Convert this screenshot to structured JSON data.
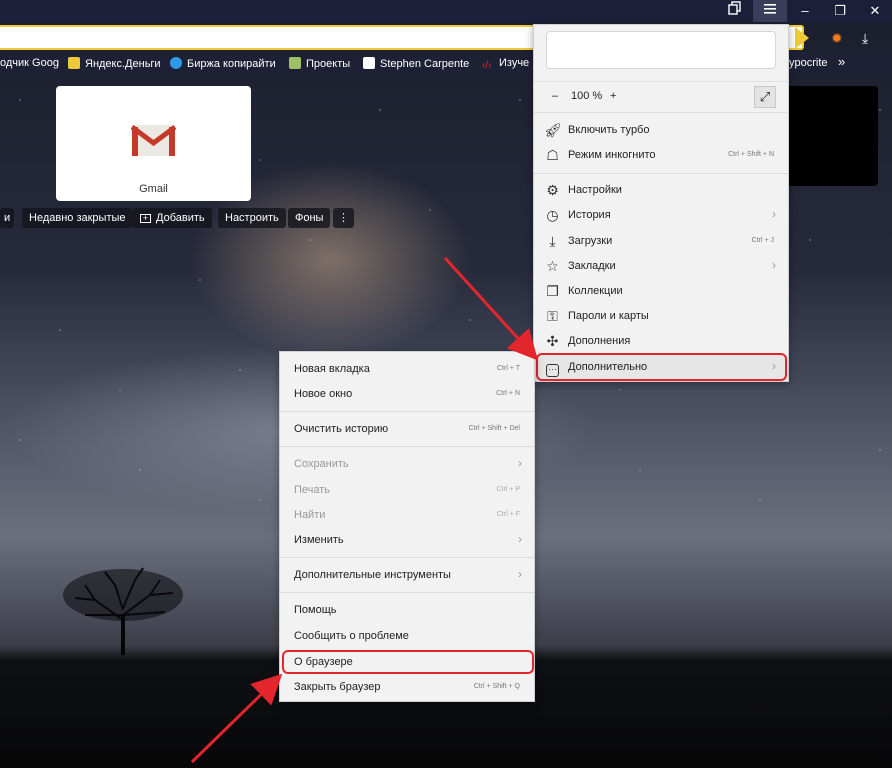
{
  "window": {
    "collections_icon": "collections-icon",
    "menu_icon": "hamburger-menu-icon",
    "minimize": "–",
    "restore": "❐",
    "close": "✕",
    "download": "⤓"
  },
  "bookmarks": [
    {
      "label": "одчик Goog",
      "color": "#ffffff"
    },
    {
      "label": "Яндекс.Деньги",
      "color": "#f0c93a"
    },
    {
      "label": "Биржа копирайти",
      "color": "#2d9ae6"
    },
    {
      "label": "Проекты",
      "color": "#9fbf6a"
    },
    {
      "label": "Stephen Carpente",
      "color": "#ffffff"
    },
    {
      "label": "Изуче",
      "color": "#e3262c"
    }
  ],
  "bookmarks_more_fragment": "ypocrite",
  "bookmarks_chevron": "»",
  "tile": {
    "label": "Gmail"
  },
  "toolbar": {
    "left_fragment": "и",
    "recently_closed": "Недавно закрытые",
    "add": "Добавить",
    "configure": "Настроить",
    "backgrounds": "Фоны",
    "more": "⋮"
  },
  "main_menu": {
    "zoom_minus": "–",
    "zoom_value": "100 %",
    "zoom_plus": "+",
    "items": [
      {
        "label": "Включить турбо",
        "icon": "rocket-icon",
        "shortcut": "",
        "arrow": ""
      },
      {
        "label": "Режим инкогнито",
        "icon": "incognito-icon",
        "shortcut": "Ctrl + Shift + N",
        "arrow": ""
      },
      {
        "label": "Настройки",
        "icon": "gear-icon",
        "shortcut": "",
        "arrow": ""
      },
      {
        "label": "История",
        "icon": "clock-icon",
        "shortcut": "",
        "arrow": "›"
      },
      {
        "label": "Загрузки",
        "icon": "download-icon",
        "shortcut": "Ctrl + J",
        "arrow": ""
      },
      {
        "label": "Закладки",
        "icon": "star-icon",
        "shortcut": "",
        "arrow": "›"
      },
      {
        "label": "Коллекции",
        "icon": "collections-icon",
        "shortcut": "",
        "arrow": ""
      },
      {
        "label": "Пароли и карты",
        "icon": "key-icon",
        "shortcut": "",
        "arrow": ""
      },
      {
        "label": "Дополнения",
        "icon": "puzzle-icon",
        "shortcut": "",
        "arrow": ""
      },
      {
        "label": "Дополнительно",
        "icon": "more-icon",
        "shortcut": "",
        "arrow": "›"
      }
    ]
  },
  "sub_menu": {
    "items": [
      {
        "label": "Новая вкладка",
        "shortcut": "Ctrl + T",
        "arrow": ""
      },
      {
        "label": "Новое окно",
        "shortcut": "Ctrl + N",
        "arrow": ""
      },
      {
        "label": "Очистить историю",
        "shortcut": "Ctrl + Shift + Del",
        "arrow": ""
      },
      {
        "label": "Сохранить",
        "shortcut": "",
        "arrow": "›"
      },
      {
        "label": "Печать",
        "shortcut": "Ctrl + P",
        "arrow": ""
      },
      {
        "label": "Найти",
        "shortcut": "Ctrl + F",
        "arrow": ""
      },
      {
        "label": "Изменить",
        "shortcut": "",
        "arrow": "›"
      },
      {
        "label": "Дополнительные инструменты",
        "shortcut": "",
        "arrow": "›"
      },
      {
        "label": "Помощь",
        "shortcut": "",
        "arrow": ""
      },
      {
        "label": "Сообщить о проблеме",
        "shortcut": "",
        "arrow": ""
      },
      {
        "label": "О браузере",
        "shortcut": "",
        "arrow": ""
      },
      {
        "label": "Закрыть браузер",
        "shortcut": "Ctrl + Shift + Q",
        "arrow": ""
      }
    ]
  },
  "colors": {
    "highlight": "#e3262c",
    "accent": "#f0c93a"
  }
}
